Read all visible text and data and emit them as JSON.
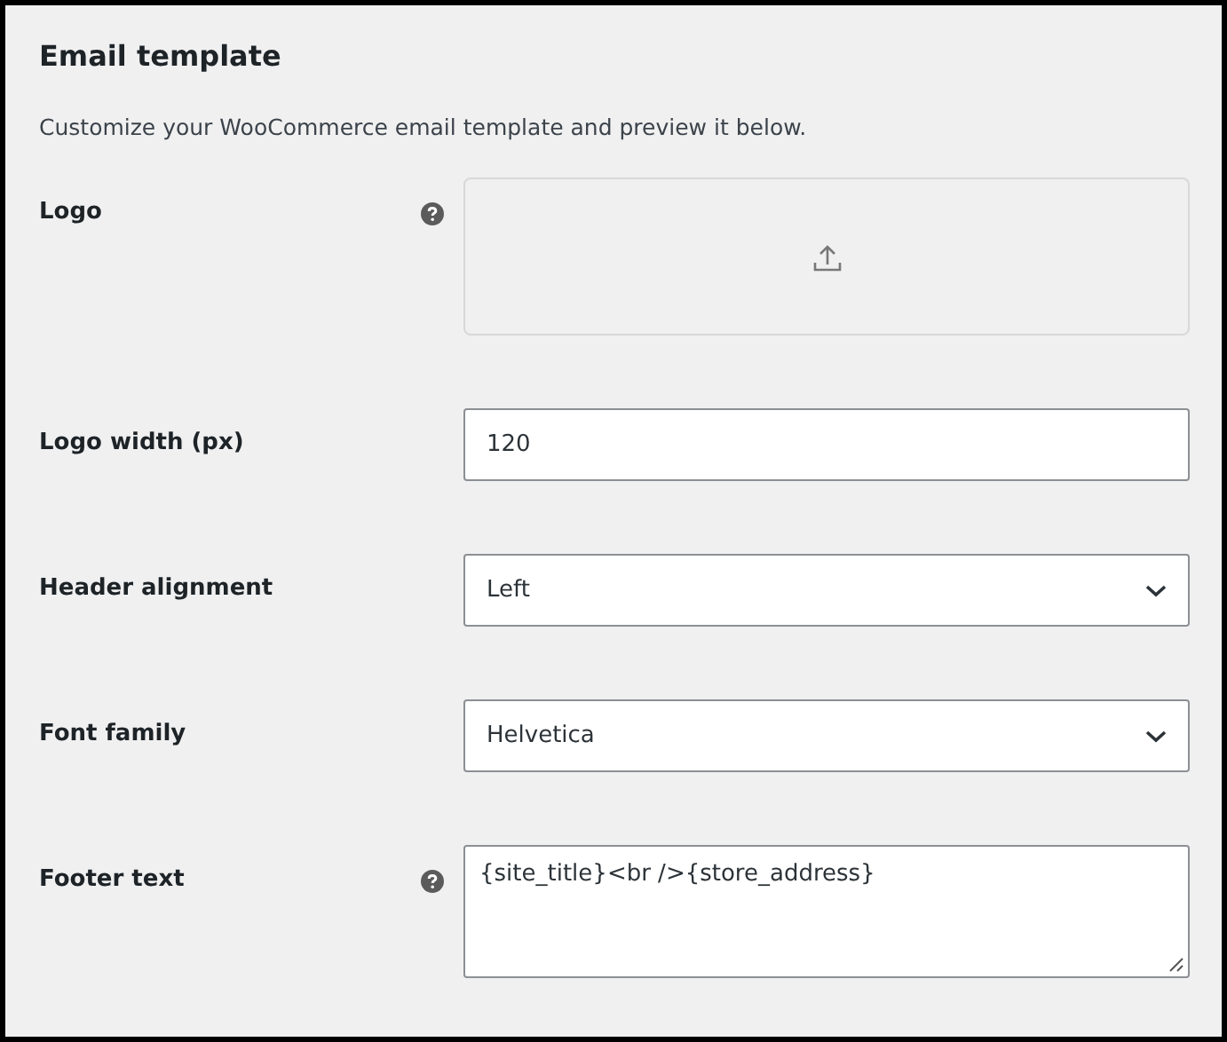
{
  "title": "Email template",
  "description": "Customize your WooCommerce email template and preview it below.",
  "fields": [
    {
      "kind": "upload",
      "label": "Logo",
      "help": true
    },
    {
      "kind": "text",
      "label": "Logo width (px)",
      "help": false,
      "value": "120"
    },
    {
      "kind": "select",
      "label": "Header alignment",
      "help": false,
      "value": "Left"
    },
    {
      "kind": "select",
      "label": "Font family",
      "help": false,
      "value": "Helvetica"
    },
    {
      "kind": "textarea",
      "label": "Footer text",
      "help": true,
      "value": "{site_title}<br />{store_address}"
    }
  ]
}
